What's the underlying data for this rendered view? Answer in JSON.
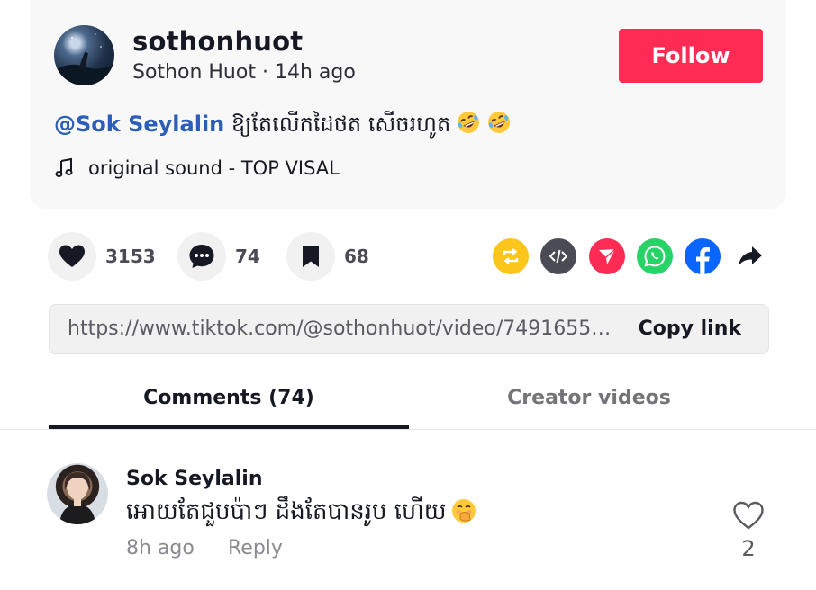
{
  "post": {
    "username": "sothonhuot",
    "display_name": "Sothon Huot",
    "separator": " · ",
    "time_ago": "14h ago",
    "follow_label": "Follow",
    "mention": "@Sok Seylalin",
    "caption": "ឱ្យតែលើកដៃថត សើចរហូត",
    "caption_emoji": "rolling-on-floor-laughing",
    "sound_label": "original sound - TOP  VISAL"
  },
  "stats": {
    "likes": "3153",
    "comments": "74",
    "saves": "68"
  },
  "share_targets": [
    "repost-icon",
    "embed-icon",
    "send-icon",
    "whatsapp-icon",
    "facebook-icon",
    "share-arrow-icon"
  ],
  "link": {
    "url": "https://www.tiktok.com/@sothonhuot/video/74916552...",
    "copy_label": "Copy link"
  },
  "tabs": {
    "comments": "Comments (74)",
    "creator_videos": "Creator videos"
  },
  "comment": {
    "author": "Sok Seylalin",
    "text": "អោយតែជួបប៉ាៗ ដឹងតែបានរូប ហើយ",
    "text_emoji": "face-with-hand-over-mouth",
    "time_ago": "8h ago",
    "reply_label": "Reply",
    "like_count": "2"
  },
  "colors": {
    "accent": "#fe2c55",
    "mention": "#2b5db9",
    "repost": "#fcc51c",
    "embed": "#4b4b55",
    "send": "#fe2c55",
    "whatsapp": "#25d366",
    "facebook": "#0866ff"
  }
}
